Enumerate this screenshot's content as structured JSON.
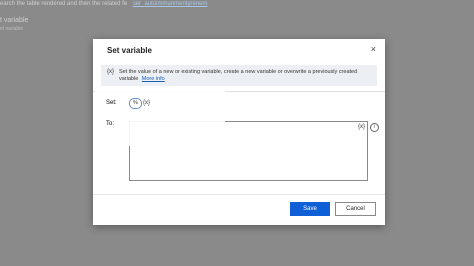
{
  "background": {
    "line1_text": "earch the table rendered and then the related fe",
    "line1_link": "ser_autoimmunmentyrenem",
    "line2_text": "t variable",
    "line3_text": "et variable"
  },
  "dialog": {
    "title": "Set variable",
    "close_glyph": "×",
    "info": {
      "icon": "{x}",
      "text": "Set the value of a new or existing variable, create a new variable or overwrite a previously created variable",
      "link": "More info"
    },
    "set": {
      "label": "Set:",
      "value": "%",
      "var_button": "{x}"
    },
    "to": {
      "label": "To:",
      "value": "",
      "var_button": "{x}",
      "help_glyph": "i"
    },
    "buttons": {
      "save": "Save",
      "cancel": "Cancel"
    }
  },
  "colors": {
    "accent": "#0f5fd6",
    "overlay": "#8a8a8a"
  }
}
